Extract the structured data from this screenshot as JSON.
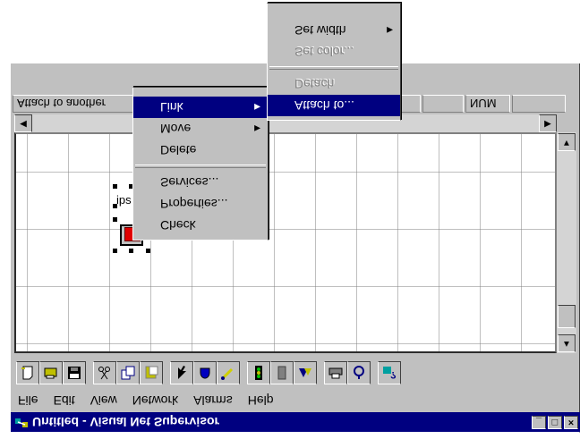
{
  "window": {
    "title": "Untitled - Visual Net Supervisor",
    "controls": [
      "_",
      "□",
      "×"
    ]
  },
  "menubar": [
    "File",
    "Edit",
    "View",
    "Network",
    "Alarms",
    "Help"
  ],
  "toolbar": [
    {
      "icon": "new-icon"
    },
    {
      "icon": "open-icon"
    },
    {
      "icon": "save-icon"
    },
    {
      "icon": "cut-icon"
    },
    {
      "icon": "copy-icon"
    },
    {
      "icon": "paste-icon"
    },
    {
      "icon": "pointer-icon"
    },
    {
      "icon": "hand-icon"
    },
    {
      "icon": "link-icon"
    },
    {
      "icon": "signal-icon"
    },
    {
      "icon": "device-icon"
    },
    {
      "icon": "connect-icon"
    },
    {
      "icon": "print-icon"
    },
    {
      "icon": "alarm-icon"
    },
    {
      "icon": "help-icon"
    }
  ],
  "canvas": {
    "node_label": "ips"
  },
  "status": {
    "message": "Attach to another",
    "num": "NUM"
  },
  "context_menu": {
    "items": [
      {
        "label": "Link",
        "submenu": true,
        "selected": true
      },
      {
        "label": "Move",
        "submenu": true
      },
      {
        "label": "Delete"
      },
      {
        "label": "Services..."
      },
      {
        "label": "Properties..."
      },
      {
        "label": "Check"
      }
    ]
  },
  "link_submenu": {
    "items": [
      {
        "label": "Set width",
        "submenu": true
      },
      {
        "label": "Set color...",
        "disabled": true
      },
      {
        "label": "Detach",
        "disabled": true
      },
      {
        "label": "Attach to...",
        "selected": true
      }
    ]
  },
  "colors": {
    "title_bar": "#000080",
    "face": "#c0c0c0",
    "selection": "#000080",
    "node_fill": "#e00000"
  }
}
